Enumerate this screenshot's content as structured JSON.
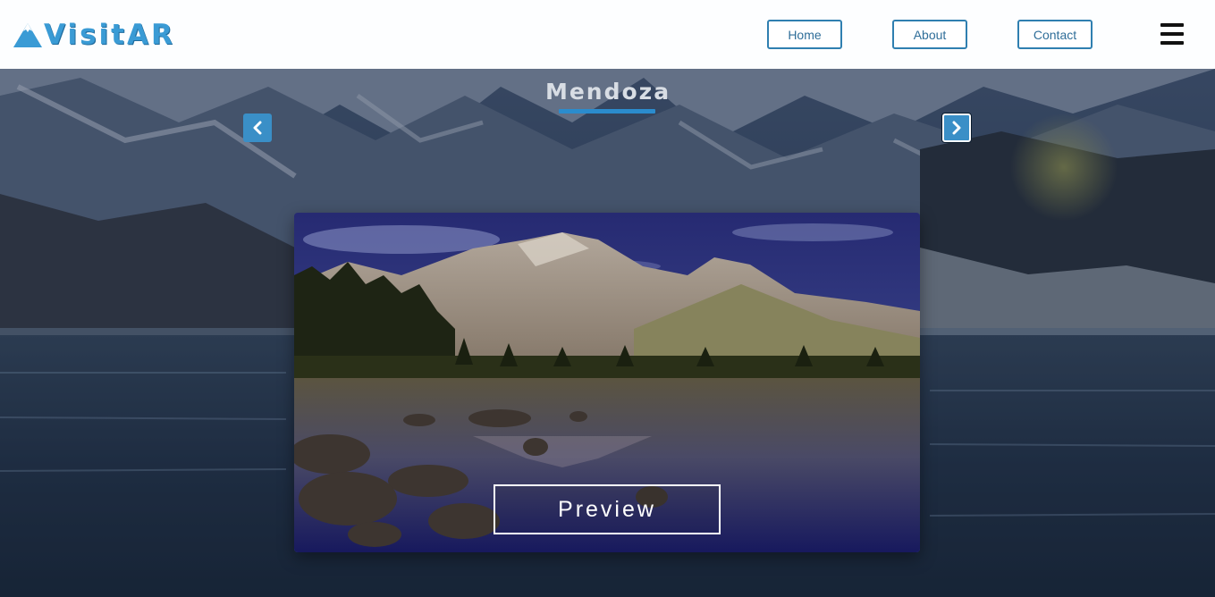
{
  "header": {
    "brand_text": "VisitAR",
    "nav": [
      {
        "label": "Home"
      },
      {
        "label": "About"
      },
      {
        "label": "Contact"
      }
    ],
    "menu_icon": "hamburger-icon"
  },
  "hero": {
    "city_name": "Mendoza",
    "prev_icon": "chevron-left-icon",
    "next_icon": "chevron-right-icon",
    "preview_label": "Preview"
  },
  "colors": {
    "accent": "#3a9bd5",
    "nav_border": "#2f7fb0",
    "underline": "#2b8ccd",
    "arrow_bg": "#3a8fc7"
  }
}
